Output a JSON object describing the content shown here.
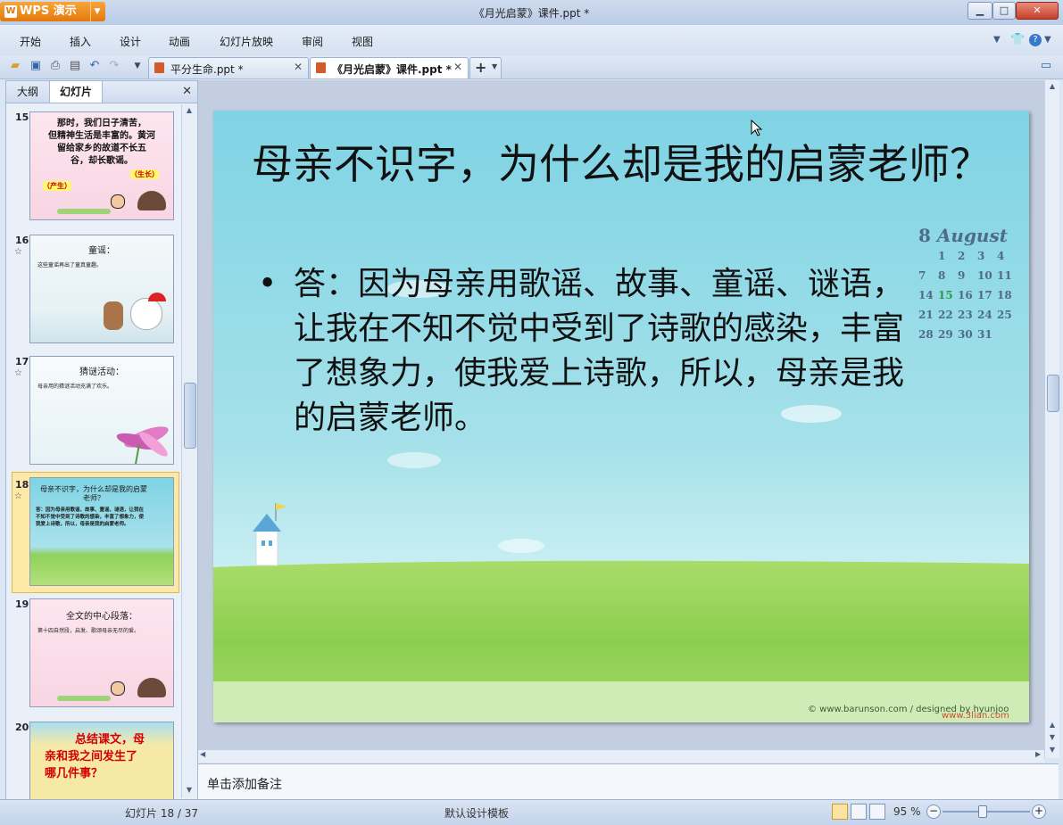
{
  "window": {
    "app_name": "WPS 演示",
    "title": "《月光启蒙》课件.ppt *",
    "controls": {
      "minimize": "▁",
      "maximize": "□",
      "close": "✕"
    }
  },
  "menu": {
    "items": [
      "开始",
      "插入",
      "设计",
      "动画",
      "幻灯片放映",
      "审阅",
      "视图"
    ],
    "right_icons": [
      "chevron-down-icon",
      "shirt-icon",
      "help-icon"
    ]
  },
  "doc_tabs": [
    {
      "label": "平分生命.ppt *",
      "active": false
    },
    {
      "label": "《月光启蒙》课件.ppt *",
      "active": true
    }
  ],
  "left_panel": {
    "tabs": [
      "大纲",
      "幻灯片"
    ],
    "active_tab": "幻灯片",
    "thumbnails": [
      {
        "number": "15",
        "has_star": false,
        "lines": [
          "那时，我们日子清苦，",
          "但精神生活是丰富的。黄河",
          "留给家乡的故道不长五",
          "谷，却长歌谣。"
        ],
        "tags": [
          "（生长）",
          "（产生）"
        ]
      },
      {
        "number": "16",
        "has_star": true,
        "title": "童谣：",
        "bullet": "这些童谣再出了童真童趣。"
      },
      {
        "number": "17",
        "has_star": true,
        "title": "猜谜活动：",
        "bullet": "母亲用的猜谜活动充满了欢乐。"
      },
      {
        "number": "18",
        "has_star": true,
        "selected": true,
        "title": "母亲不识字，为什么却是我的启蒙老师？",
        "bullet": "答：因为母亲用歌谣、故事、童谣、谜语，让我在不知不觉中受到了诗歌的感染，丰富了想象力，使我爱上诗歌，所以，母亲是我的启蒙老师。"
      },
      {
        "number": "19",
        "has_star": false,
        "title": "全文的中心段落：",
        "bullet": "第十四自然段，启发、歌颂母亲无尽的爱。"
      },
      {
        "number": "20",
        "has_star": false,
        "lines": [
          "总结课文，母",
          "亲和我之间发生了",
          "哪几件事？"
        ]
      }
    ]
  },
  "slide": {
    "title": "母亲不识字，为什么却是我的启蒙老师？",
    "bullet_marker": "•",
    "body": "答：因为母亲用歌谣、故事、童谣、谜语，让我在不知不觉中受到了诗歌的感染，丰富了想象力，使我爱上诗歌，所以，母亲是我的启蒙老师。",
    "calendar": {
      "day": "8",
      "month": "August",
      "rows": [
        [
          "",
          "1",
          "2",
          "3",
          "4"
        ],
        [
          "7",
          "8",
          "9",
          "10",
          "11"
        ],
        [
          "14",
          "15",
          "16",
          "17",
          "18"
        ],
        [
          "21",
          "22",
          "23",
          "24",
          "25"
        ],
        [
          "28",
          "29",
          "30",
          "31",
          ""
        ]
      ]
    },
    "credit": "© www.barunson.com / designed by hyunjoo",
    "watermark": "www.3lian.com"
  },
  "notes_placeholder": "单击添加备注",
  "status": {
    "slide_position": "幻灯片 18 / 37",
    "template": "默认设计模板",
    "zoom": "95 %"
  },
  "colors": {
    "accent_orange": "#e4780c",
    "selection": "#f5c75a",
    "sky": "#7fd3e4",
    "grass": "#8fd15a"
  }
}
